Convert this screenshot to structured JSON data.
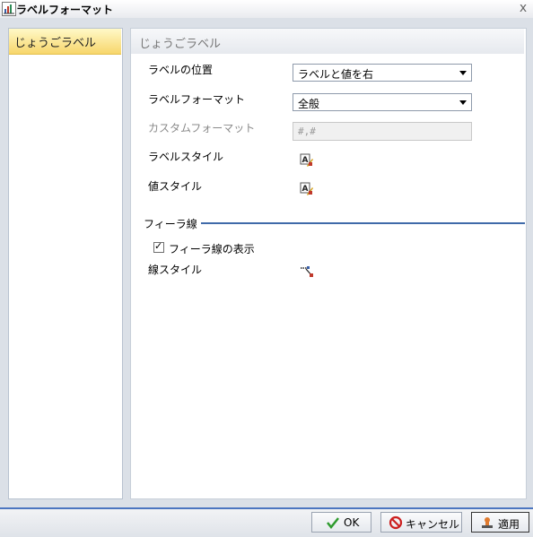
{
  "window": {
    "title": "ラベルフォーマット",
    "close_glyph": "x"
  },
  "sidebar": {
    "items": [
      {
        "label": "じょうごラベル",
        "selected": true
      }
    ]
  },
  "main": {
    "section_title": "じょうごラベル",
    "fields": {
      "label_position": {
        "label": "ラベルの位置",
        "value": "ラベルと値を右"
      },
      "label_format": {
        "label": "ラベルフォーマット",
        "value": "全般"
      },
      "custom_format": {
        "label": "カスタムフォーマット",
        "value": "#,#",
        "disabled": true
      },
      "label_style": {
        "label": "ラベルスタイル",
        "icon": "font-style-icon"
      },
      "value_style": {
        "label": "値スタイル",
        "icon": "font-style-icon"
      }
    },
    "feeder": {
      "section_label": "フィーラ線",
      "show_checkbox": {
        "label": "フィーラ線の表示",
        "checked": true
      },
      "line_style": {
        "label": "線スタイル",
        "icon": "line-style-icon"
      }
    }
  },
  "footer": {
    "ok_label": "OK",
    "cancel_label": "キャンセル",
    "apply_label": "適用"
  },
  "colors": {
    "accent": "#4c76c0",
    "selected_item": "#f7d66b",
    "divider": "#3f6aa9"
  }
}
